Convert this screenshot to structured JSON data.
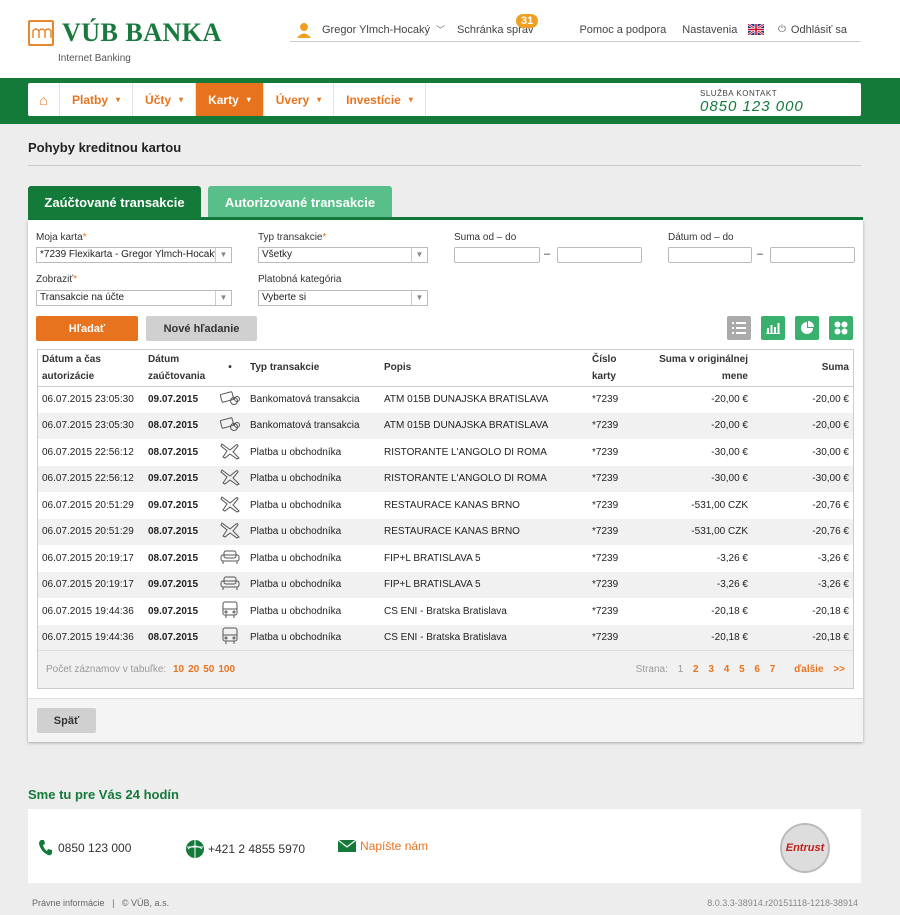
{
  "header": {
    "brand": "VÚB BANKA",
    "subtitle": "Internet Banking",
    "user_name": "Gregor Ylmch-Hocaký",
    "inbox_label": "Schránka správ",
    "inbox_count": "31",
    "help_label": "Pomoc a podpora",
    "settings_label": "Nastavenia",
    "logout_label": "Odhlásiť sa"
  },
  "nav": {
    "items": [
      {
        "label": "Platby"
      },
      {
        "label": "Účty"
      },
      {
        "label": "Karty"
      },
      {
        "label": "Úvery"
      },
      {
        "label": "Investície"
      }
    ],
    "active_index": 2,
    "contact_label": "SLUŽBA KONTAKT",
    "contact_number": "0850 123 000"
  },
  "page": {
    "title": "Pohyby kreditnou kartou",
    "tabs": [
      {
        "label": "Zaúčtované transakcie"
      },
      {
        "label": "Autorizované transakcie"
      }
    ]
  },
  "filters": {
    "card_label": "Moja karta",
    "card_value": "*7239 Flexikarta - Gregor Ylmch-Hocaký",
    "type_label": "Typ transakcie",
    "type_value": "Všetky",
    "amount_label": "Suma od – do",
    "date_label": "Dátum od – do",
    "show_label": "Zobraziť",
    "show_value": "Transakcie na účte",
    "category_label": "Platobná kategória",
    "category_value": "Vyberte si",
    "required_mark": "*",
    "range_separator": "–",
    "search_button": "Hľadať",
    "new_search_button": "Nové hľadanie"
  },
  "table": {
    "columns": {
      "auth_date": "Dátum a čas autorizácie",
      "post_date": "Dátum zaúčtovania",
      "dot": "•",
      "type": "Typ transakcie",
      "desc": "Popis",
      "card": "Číslo karty",
      "orig_amount": "Suma v originálnej mene",
      "amount": "Suma"
    },
    "rows": [
      {
        "auth": "06.07.2015 23:05:30",
        "post": "09.07.2015",
        "icon": "atm-icon",
        "type": "Bankomatová transakcia",
        "desc": "ATM 015B DUNAJSKA BRATISLAVA",
        "card": "*7239",
        "orig": "-20,00 €",
        "amount": "-20,00 €"
      },
      {
        "auth": "06.07.2015 23:05:30",
        "post": "08.07.2015",
        "icon": "atm-icon",
        "type": "Bankomatová transakcia",
        "desc": "ATM 015B DUNAJSKA BRATISLAVA",
        "card": "*7239",
        "orig": "-20,00 €",
        "amount": "-20,00 €"
      },
      {
        "auth": "06.07.2015 22:56:12",
        "post": "08.07.2015",
        "icon": "plane-icon",
        "type": "Platba u obchodníka",
        "desc": "RISTORANTE L'ANGOLO DI ROMA",
        "card": "*7239",
        "orig": "-30,00 €",
        "amount": "-30,00 €"
      },
      {
        "auth": "06.07.2015 22:56:12",
        "post": "09.07.2015",
        "icon": "plane-icon",
        "type": "Platba u obchodníka",
        "desc": "RISTORANTE L'ANGOLO DI ROMA",
        "card": "*7239",
        "orig": "-30,00 €",
        "amount": "-30,00 €"
      },
      {
        "auth": "06.07.2015 20:51:29",
        "post": "09.07.2015",
        "icon": "plane-icon",
        "type": "Platba u obchodníka",
        "desc": "RESTAURACE KANAS BRNO",
        "card": "*7239",
        "orig": "-531,00 CZK",
        "amount": "-20,76 €"
      },
      {
        "auth": "06.07.2015 20:51:29",
        "post": "08.07.2015",
        "icon": "plane-icon",
        "type": "Platba u obchodníka",
        "desc": "RESTAURACE KANAS BRNO",
        "card": "*7239",
        "orig": "-531,00 CZK",
        "amount": "-20,76 €"
      },
      {
        "auth": "06.07.2015 20:19:17",
        "post": "08.07.2015",
        "icon": "sofa-icon",
        "type": "Platba u obchodníka",
        "desc": "FIP+L BRATISLAVA 5",
        "card": "*7239",
        "orig": "-3,26 €",
        "amount": "-3,26 €"
      },
      {
        "auth": "06.07.2015 20:19:17",
        "post": "09.07.2015",
        "icon": "sofa-icon",
        "type": "Platba u obchodníka",
        "desc": "FIP+L BRATISLAVA 5",
        "card": "*7239",
        "orig": "-3,26 €",
        "amount": "-3,26 €"
      },
      {
        "auth": "06.07.2015 19:44:36",
        "post": "09.07.2015",
        "icon": "bus-icon",
        "type": "Platba u obchodníka",
        "desc": "CS ENI - Bratska Bratislava",
        "card": "*7239",
        "orig": "-20,18 €",
        "amount": "-20,18 €"
      },
      {
        "auth": "06.07.2015 19:44:36",
        "post": "08.07.2015",
        "icon": "bus-icon",
        "type": "Platba u obchodníka",
        "desc": "CS ENI - Bratska Bratislava",
        "card": "*7239",
        "orig": "-20,18 €",
        "amount": "-20,18 €"
      }
    ],
    "page_size_label": "Počet záznamov v tabuľke:",
    "page_sizes": [
      "10",
      "20",
      "50",
      "100"
    ],
    "pages_label": "Strana:",
    "pages": [
      "1",
      "2",
      "3",
      "4",
      "5",
      "6",
      "7"
    ],
    "next_label": "ďalšie",
    "next_arrows": ">>"
  },
  "back_button": "Späť",
  "footer": {
    "section_title": "Sme tu pre Vás 24 hodín",
    "phone": "0850 123 000",
    "intl_phone": "+421 2 4855 5970",
    "write_label": "Napíšte nám",
    "entrust_label": "Entrust",
    "legal": "Právne informácie",
    "separator": "|",
    "copyright": "© VÚB, a.s.",
    "version": "8.0.3.3-38914.r20151118-1218-38914"
  },
  "colors": {
    "green": "#137a3a",
    "light_green": "#58bf8a",
    "orange": "#e8731e"
  }
}
